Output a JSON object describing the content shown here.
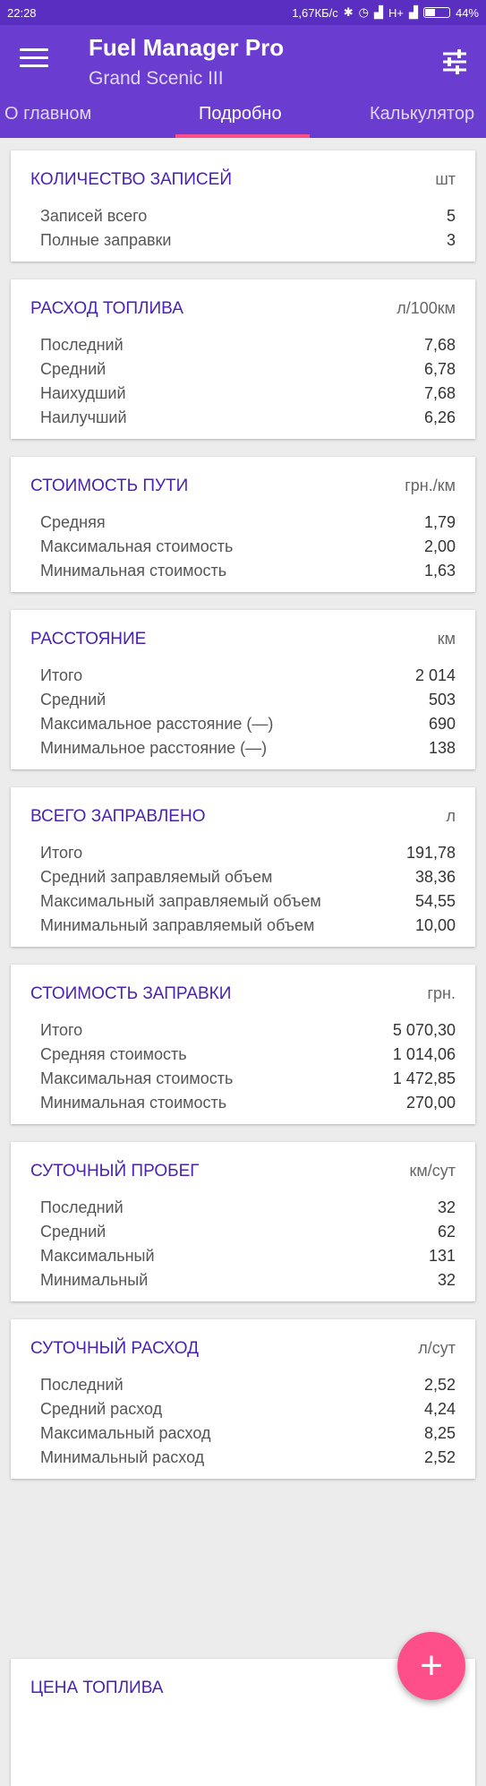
{
  "status_bar": {
    "time": "22:28",
    "speed": "1,67КБ/с",
    "network": "H+",
    "battery": "44%",
    "battery_level": 0.44
  },
  "app": {
    "title": "Fuel Manager Pro",
    "subtitle": "Grand Scenic III"
  },
  "tabs": [
    {
      "label": "О главном"
    },
    {
      "label": "Подробно"
    },
    {
      "label": "Калькулятор"
    }
  ],
  "active_tab": 1,
  "cards": [
    {
      "title": "КОЛИЧЕСТВО ЗАПИСЕЙ",
      "unit": "шт",
      "rows": [
        {
          "label": "Записей всего",
          "value": "5"
        },
        {
          "label": "Полные заправки",
          "value": "3"
        }
      ]
    },
    {
      "title": "РАСХОД ТОПЛИВА",
      "unit": "л/100км",
      "rows": [
        {
          "label": "Последний",
          "value": "7,68"
        },
        {
          "label": "Средний",
          "value": "6,78"
        },
        {
          "label": "Наихудший",
          "value": "7,68"
        },
        {
          "label": "Наилучший",
          "value": "6,26"
        }
      ]
    },
    {
      "title": "СТОИМОСТЬ ПУТИ",
      "unit": "грн./км",
      "rows": [
        {
          "label": "Средняя",
          "value": "1,79"
        },
        {
          "label": "Максимальная стоимость",
          "value": "2,00"
        },
        {
          "label": "Минимальная стоимость",
          "value": "1,63"
        }
      ]
    },
    {
      "title": "РАССТОЯНИЕ",
      "unit": "км",
      "rows": [
        {
          "label": "Итого",
          "value": "2 014"
        },
        {
          "label": "Средний",
          "value": "503"
        },
        {
          "label": "Максимальное расстояние (—)",
          "value": "690"
        },
        {
          "label": "Минимальное расстояние (—)",
          "value": "138"
        }
      ]
    },
    {
      "title": "ВСЕГО ЗАПРАВЛЕНО",
      "unit": "л",
      "rows": [
        {
          "label": "Итого",
          "value": "191,78"
        },
        {
          "label": "Средний заправляемый объем",
          "value": "38,36"
        },
        {
          "label": "Максимальный заправляемый объем",
          "value": "54,55"
        },
        {
          "label": "Минимальный заправляемый объем",
          "value": "10,00"
        }
      ]
    },
    {
      "title": "СТОИМОСТЬ ЗАПРАВКИ",
      "unit": "грн.",
      "rows": [
        {
          "label": "Итого",
          "value": "5 070,30"
        },
        {
          "label": "Средняя стоимость",
          "value": "1 014,06"
        },
        {
          "label": "Максимальная стоимость",
          "value": "1 472,85"
        },
        {
          "label": "Минимальная стоимость",
          "value": "270,00"
        }
      ]
    },
    {
      "title": "СУТОЧНЫЙ ПРОБЕГ",
      "unit": "км/сут",
      "rows": [
        {
          "label": "Последний",
          "value": "32"
        },
        {
          "label": "Средний",
          "value": "62"
        },
        {
          "label": "Максимальный",
          "value": "131"
        },
        {
          "label": "Минимальный",
          "value": "32"
        }
      ]
    },
    {
      "title": "СУТОЧНЫЙ РАСХОД",
      "unit": "л/сут",
      "rows": [
        {
          "label": "Последний",
          "value": "2,52"
        },
        {
          "label": "Средний расход",
          "value": "4,24"
        },
        {
          "label": "Максимальный расход",
          "value": "8,25"
        },
        {
          "label": "Минимальный расход",
          "value": "2,52"
        }
      ]
    }
  ],
  "partial_card": {
    "title": "ЦЕНА ТОПЛИВА"
  },
  "fab": {
    "label": "+"
  },
  "colors": {
    "primary": "#6a3ccf",
    "status_bar": "#5a2ec0",
    "accent": "#ff4f8a",
    "card_title": "#4a22b3"
  }
}
